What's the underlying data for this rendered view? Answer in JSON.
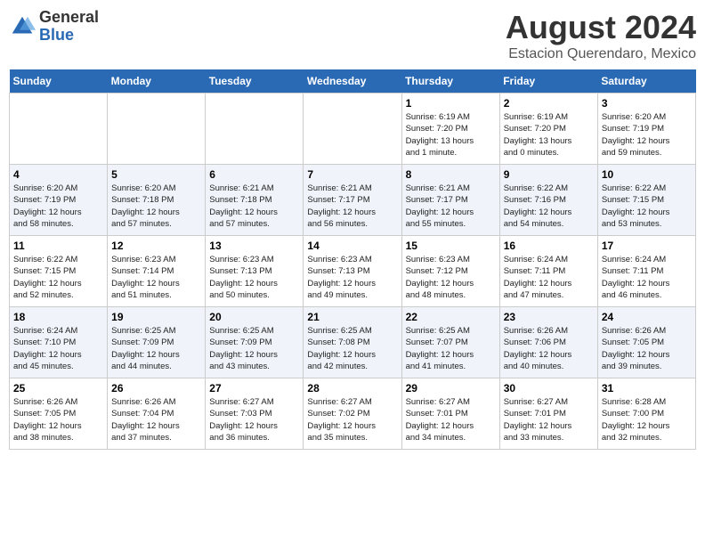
{
  "logo": {
    "general": "General",
    "blue": "Blue"
  },
  "title": "August 2024",
  "subtitle": "Estacion Querendaro, Mexico",
  "days_of_week": [
    "Sunday",
    "Monday",
    "Tuesday",
    "Wednesday",
    "Thursday",
    "Friday",
    "Saturday"
  ],
  "weeks": [
    [
      {
        "day": "",
        "info": ""
      },
      {
        "day": "",
        "info": ""
      },
      {
        "day": "",
        "info": ""
      },
      {
        "day": "",
        "info": ""
      },
      {
        "day": "1",
        "info": "Sunrise: 6:19 AM\nSunset: 7:20 PM\nDaylight: 13 hours\nand 1 minute."
      },
      {
        "day": "2",
        "info": "Sunrise: 6:19 AM\nSunset: 7:20 PM\nDaylight: 13 hours\nand 0 minutes."
      },
      {
        "day": "3",
        "info": "Sunrise: 6:20 AM\nSunset: 7:19 PM\nDaylight: 12 hours\nand 59 minutes."
      }
    ],
    [
      {
        "day": "4",
        "info": "Sunrise: 6:20 AM\nSunset: 7:19 PM\nDaylight: 12 hours\nand 58 minutes."
      },
      {
        "day": "5",
        "info": "Sunrise: 6:20 AM\nSunset: 7:18 PM\nDaylight: 12 hours\nand 57 minutes."
      },
      {
        "day": "6",
        "info": "Sunrise: 6:21 AM\nSunset: 7:18 PM\nDaylight: 12 hours\nand 57 minutes."
      },
      {
        "day": "7",
        "info": "Sunrise: 6:21 AM\nSunset: 7:17 PM\nDaylight: 12 hours\nand 56 minutes."
      },
      {
        "day": "8",
        "info": "Sunrise: 6:21 AM\nSunset: 7:17 PM\nDaylight: 12 hours\nand 55 minutes."
      },
      {
        "day": "9",
        "info": "Sunrise: 6:22 AM\nSunset: 7:16 PM\nDaylight: 12 hours\nand 54 minutes."
      },
      {
        "day": "10",
        "info": "Sunrise: 6:22 AM\nSunset: 7:15 PM\nDaylight: 12 hours\nand 53 minutes."
      }
    ],
    [
      {
        "day": "11",
        "info": "Sunrise: 6:22 AM\nSunset: 7:15 PM\nDaylight: 12 hours\nand 52 minutes."
      },
      {
        "day": "12",
        "info": "Sunrise: 6:23 AM\nSunset: 7:14 PM\nDaylight: 12 hours\nand 51 minutes."
      },
      {
        "day": "13",
        "info": "Sunrise: 6:23 AM\nSunset: 7:13 PM\nDaylight: 12 hours\nand 50 minutes."
      },
      {
        "day": "14",
        "info": "Sunrise: 6:23 AM\nSunset: 7:13 PM\nDaylight: 12 hours\nand 49 minutes."
      },
      {
        "day": "15",
        "info": "Sunrise: 6:23 AM\nSunset: 7:12 PM\nDaylight: 12 hours\nand 48 minutes."
      },
      {
        "day": "16",
        "info": "Sunrise: 6:24 AM\nSunset: 7:11 PM\nDaylight: 12 hours\nand 47 minutes."
      },
      {
        "day": "17",
        "info": "Sunrise: 6:24 AM\nSunset: 7:11 PM\nDaylight: 12 hours\nand 46 minutes."
      }
    ],
    [
      {
        "day": "18",
        "info": "Sunrise: 6:24 AM\nSunset: 7:10 PM\nDaylight: 12 hours\nand 45 minutes."
      },
      {
        "day": "19",
        "info": "Sunrise: 6:25 AM\nSunset: 7:09 PM\nDaylight: 12 hours\nand 44 minutes."
      },
      {
        "day": "20",
        "info": "Sunrise: 6:25 AM\nSunset: 7:09 PM\nDaylight: 12 hours\nand 43 minutes."
      },
      {
        "day": "21",
        "info": "Sunrise: 6:25 AM\nSunset: 7:08 PM\nDaylight: 12 hours\nand 42 minutes."
      },
      {
        "day": "22",
        "info": "Sunrise: 6:25 AM\nSunset: 7:07 PM\nDaylight: 12 hours\nand 41 minutes."
      },
      {
        "day": "23",
        "info": "Sunrise: 6:26 AM\nSunset: 7:06 PM\nDaylight: 12 hours\nand 40 minutes."
      },
      {
        "day": "24",
        "info": "Sunrise: 6:26 AM\nSunset: 7:05 PM\nDaylight: 12 hours\nand 39 minutes."
      }
    ],
    [
      {
        "day": "25",
        "info": "Sunrise: 6:26 AM\nSunset: 7:05 PM\nDaylight: 12 hours\nand 38 minutes."
      },
      {
        "day": "26",
        "info": "Sunrise: 6:26 AM\nSunset: 7:04 PM\nDaylight: 12 hours\nand 37 minutes."
      },
      {
        "day": "27",
        "info": "Sunrise: 6:27 AM\nSunset: 7:03 PM\nDaylight: 12 hours\nand 36 minutes."
      },
      {
        "day": "28",
        "info": "Sunrise: 6:27 AM\nSunset: 7:02 PM\nDaylight: 12 hours\nand 35 minutes."
      },
      {
        "day": "29",
        "info": "Sunrise: 6:27 AM\nSunset: 7:01 PM\nDaylight: 12 hours\nand 34 minutes."
      },
      {
        "day": "30",
        "info": "Sunrise: 6:27 AM\nSunset: 7:01 PM\nDaylight: 12 hours\nand 33 minutes."
      },
      {
        "day": "31",
        "info": "Sunrise: 6:28 AM\nSunset: 7:00 PM\nDaylight: 12 hours\nand 32 minutes."
      }
    ]
  ]
}
